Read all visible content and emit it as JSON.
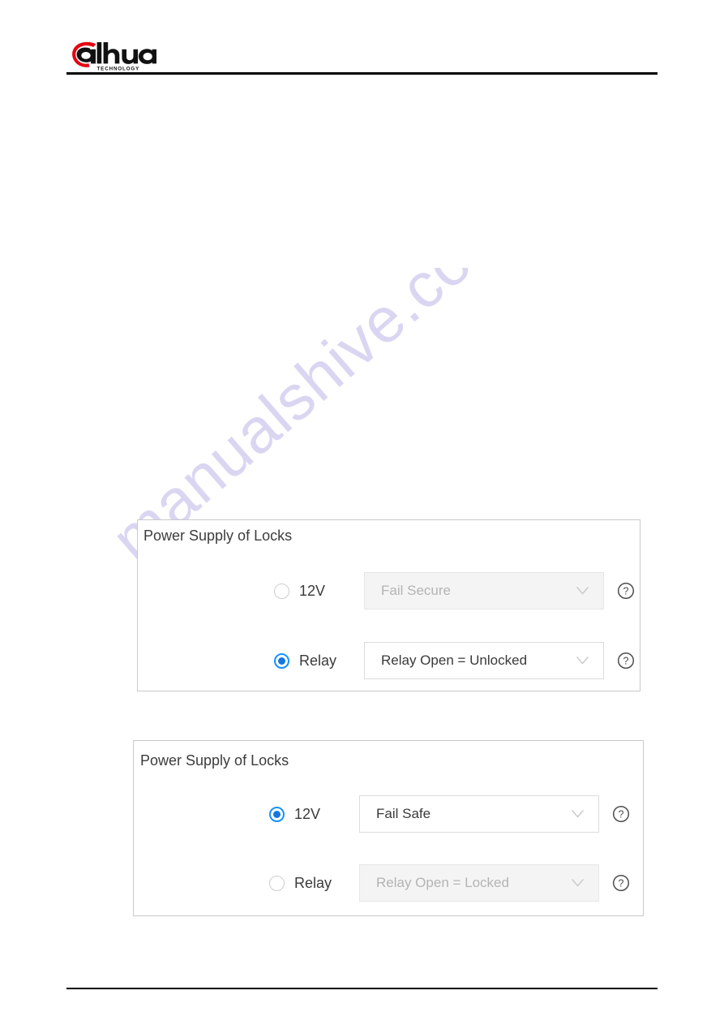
{
  "header": {
    "logo_name": "dahua-logo",
    "logo_wordmark": "alhua",
    "logo_tagline": "TECHNOLOGY",
    "logo_accent_color": "#e30613",
    "logo_text_color": "#1a1a1a"
  },
  "watermark": {
    "text": "manualshive.com",
    "color": "#d9d4f2"
  },
  "accent": {
    "radio_selected": "#1677e0",
    "radio_ring": "#1890ff",
    "border": "#c9c9c9",
    "disabled_bg": "#f4f4f4",
    "disabled_text": "#b4b4b4"
  },
  "panels": [
    {
      "title": "Power Supply of Locks",
      "rows": [
        {
          "radio_label": "12V",
          "radio_selected": false,
          "select_value": "Fail Secure",
          "select_disabled": true,
          "chevron_icon": "chevron-down-icon",
          "help_icon": "help-circle-icon"
        },
        {
          "radio_label": "Relay",
          "radio_selected": true,
          "select_value": "Relay Open = Unlocked",
          "select_disabled": false,
          "chevron_icon": "chevron-down-icon",
          "help_icon": "help-circle-icon"
        }
      ]
    },
    {
      "title": "Power Supply of Locks",
      "rows": [
        {
          "radio_label": "12V",
          "radio_selected": true,
          "select_value": "Fail Safe",
          "select_disabled": false,
          "chevron_icon": "chevron-down-icon",
          "help_icon": "help-circle-icon"
        },
        {
          "radio_label": "Relay",
          "radio_selected": false,
          "select_value": "Relay Open = Locked",
          "select_disabled": true,
          "chevron_icon": "chevron-down-icon",
          "help_icon": "help-circle-icon"
        }
      ]
    }
  ]
}
